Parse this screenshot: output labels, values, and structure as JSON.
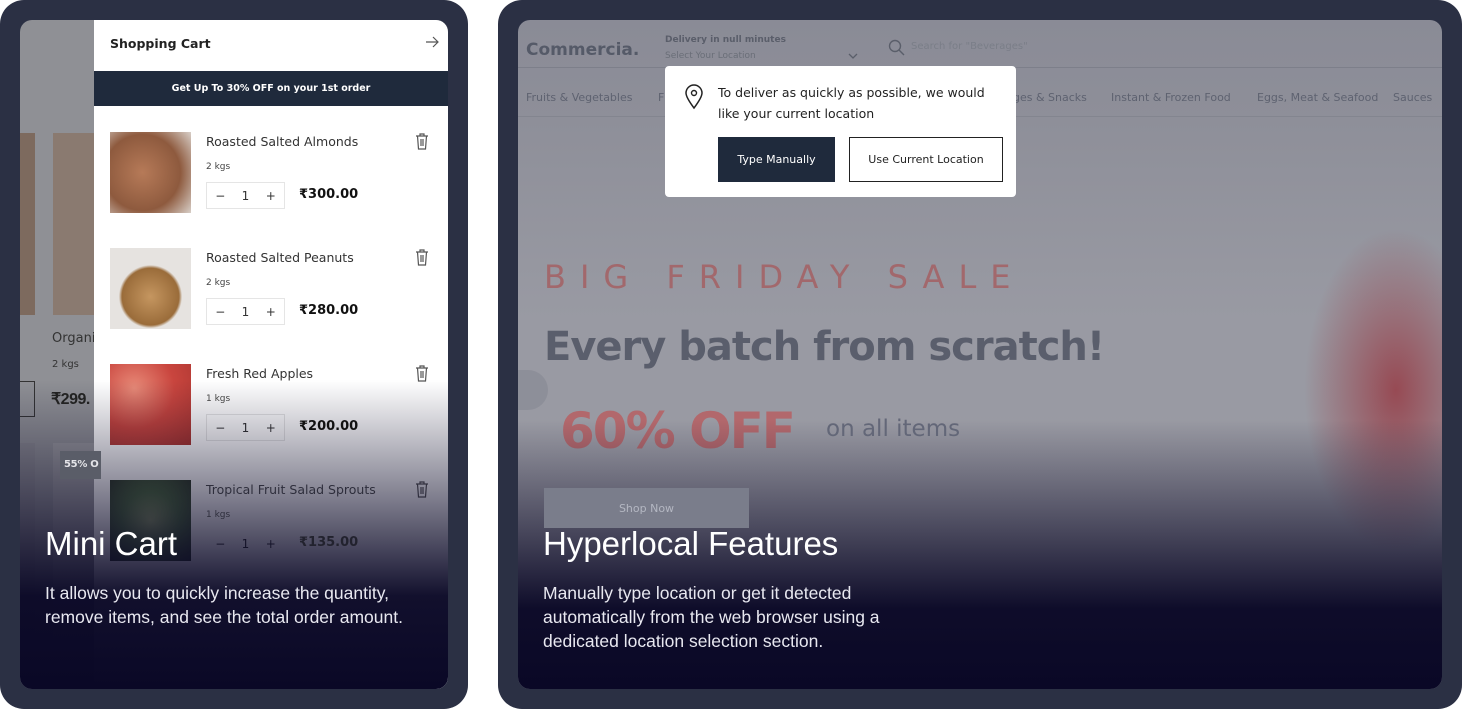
{
  "left": {
    "bg_products": {
      "name_partial": "Organi",
      "weight": "2 kgs",
      "price_partial": "₹299.",
      "badge_partial": "55% O"
    },
    "cart": {
      "title": "Shopping Cart",
      "close_icon": "arrow-right-icon",
      "banner": "Get Up To 30% OFF on your 1st order",
      "items": [
        {
          "name": "Roasted Salted Almonds",
          "weight": "2 kgs",
          "qty": "1",
          "price": "₹300.00",
          "color": "#a0684a"
        },
        {
          "name": "Roasted Salted Peanuts",
          "weight": "2 kgs",
          "qty": "1",
          "price": "₹280.00",
          "color": "#c59660"
        },
        {
          "name": "Fresh Red Apples",
          "weight": "1 kgs",
          "qty": "1",
          "price": "₹200.00",
          "color": "#d9574f"
        },
        {
          "name": "Tropical Fruit Salad Sprouts",
          "weight": "1 kgs",
          "qty": "1",
          "price": "₹135.00",
          "color": "#5c7a4a"
        }
      ],
      "minus": "−",
      "plus": "+"
    },
    "caption": {
      "title": "Mini Cart",
      "text": "It allows you to quickly increase the quantity, remove items, and see the total order amount."
    }
  },
  "right": {
    "header": {
      "logo": "Commercia.",
      "delivery_label": "Delivery in null minutes",
      "location_placeholder": "Select Your Location",
      "search_placeholder": "Search for \"Beverages\""
    },
    "nav": [
      "Fruits & Vegetables",
      "F",
      "ges & Snacks",
      "Instant & Frozen Food",
      "Eggs, Meat & Seafood",
      "Sauces"
    ],
    "popup": {
      "message": "To deliver as quickly as possible, we would like your current location",
      "type_manually": "Type Manually",
      "use_current": "Use Current Location"
    },
    "hero": {
      "kicker": "BIG FRIDAY SALE",
      "headline": "Every batch from scratch!",
      "offer": "60% OFF",
      "offer_sub": "on all items",
      "cta": "Shop Now"
    },
    "caption": {
      "title": "Hyperlocal Features",
      "text": "Manually type location or get it detected automatically from the web browser using a dedicated location selection section."
    }
  },
  "colors": {
    "frame": "#2b3044",
    "banner": "#1f2a3c",
    "accent_red": "#c85a5a"
  }
}
